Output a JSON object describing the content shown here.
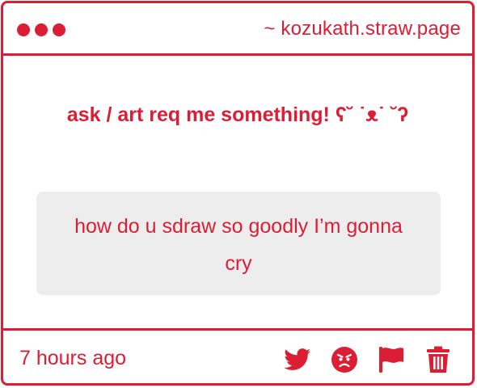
{
  "header": {
    "site": "~ kozukath.straw.page"
  },
  "prompt": {
    "text": "ask / art req me something! ʕ˘ ˙ᴥ˙ ˘ʔ"
  },
  "question": {
    "text": "how do u sdraw so goodly I’m gonna cry"
  },
  "footer": {
    "timestamp": "7 hours ago",
    "actions": [
      {
        "icon": "twitter-icon"
      },
      {
        "icon": "angry-face-icon"
      },
      {
        "icon": "flag-icon"
      },
      {
        "icon": "trash-icon"
      }
    ]
  },
  "colors": {
    "accent": "#dc1e35",
    "bubble": "#eeedee",
    "background": "#ffffff"
  }
}
